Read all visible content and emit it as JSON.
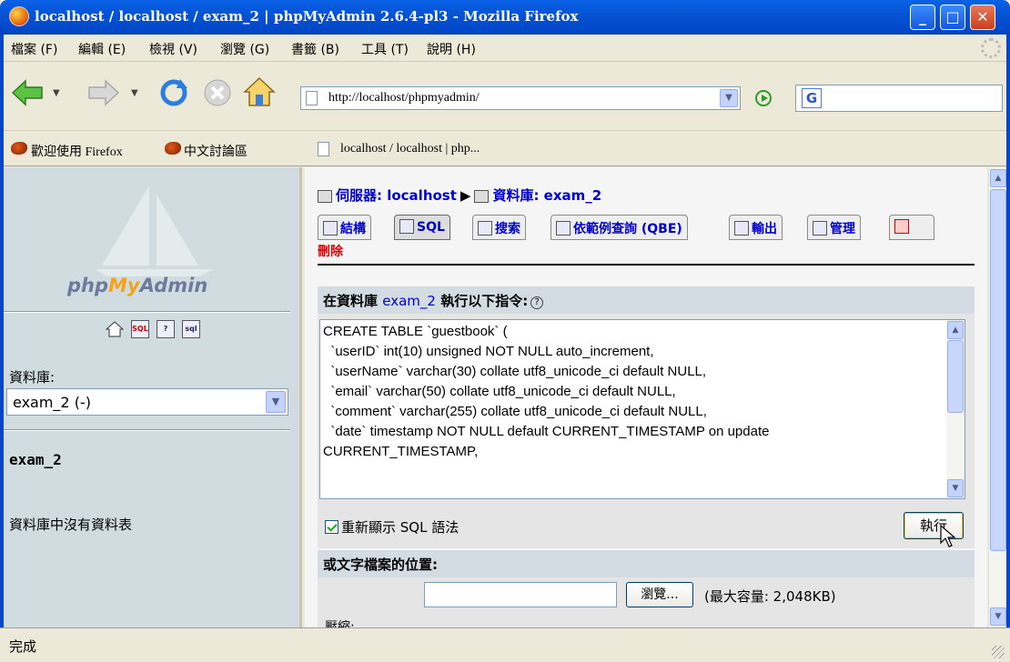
{
  "window": {
    "title": "localhost / localhost / exam_2 | phpMyAdmin 2.6.4-pl3 - Mozilla Firefox",
    "controls": {
      "minimize": "_",
      "maximize": "□",
      "close": "✕"
    }
  },
  "menu": [
    "檔案 (F)",
    "編輯 (E)",
    "檢視 (V)",
    "瀏覽 (G)",
    "書籤 (B)",
    "工具 (T)",
    "說明 (H)"
  ],
  "nav": {
    "url": "http://localhost/phpmyadmin/",
    "search_engine": "G"
  },
  "bookmarks": [
    {
      "label": "歡迎使用 Firefox",
      "icon": "firefox-bookmark-icon"
    },
    {
      "label": "中文討論區",
      "icon": "firefox-bookmark-icon"
    },
    {
      "label": "localhost / localhost | php...",
      "icon": "page-icon"
    }
  ],
  "left": {
    "logo": {
      "php": "php",
      "my": "My",
      "admin": "Admin"
    },
    "db_label": "資料庫:",
    "db_select": "exam_2 (-)",
    "db_name": "exam_2",
    "no_tables": "資料庫中沒有資料表"
  },
  "right": {
    "breadcrumb": {
      "server": "伺服器: localhost",
      "database": "資料庫: exam_2"
    },
    "tabs": [
      "結構",
      "SQL",
      "搜索",
      "依範例查詢 (QBE)",
      "輸出",
      "管理",
      "刪除"
    ],
    "active_tab": "SQL",
    "sql_header_prefix": "在資料庫",
    "sql_header_db": "exam_2",
    "sql_header_suffix": "執行以下指令:",
    "help": "?",
    "sql_text": "CREATE TABLE `guestbook` (\n  `userID` int(10) unsigned NOT NULL auto_increment,\n  `userName` varchar(30) collate utf8_unicode_ci default NULL,\n  `email` varchar(50) collate utf8_unicode_ci default NULL,\n  `comment` varchar(255) collate utf8_unicode_ci default NULL,\n  `date` timestamp NOT NULL default CURRENT_TIMESTAMP on update\nCURRENT_TIMESTAMP,",
    "show_sql_label": "重新顯示 SQL 語法",
    "go_button": "執行",
    "file_header": "或文字檔案的位置:",
    "browse_button": "瀏覽...",
    "max_size": "(最大容量: 2,048KB)",
    "compress_label": "壓縮:"
  },
  "status": "完成"
}
